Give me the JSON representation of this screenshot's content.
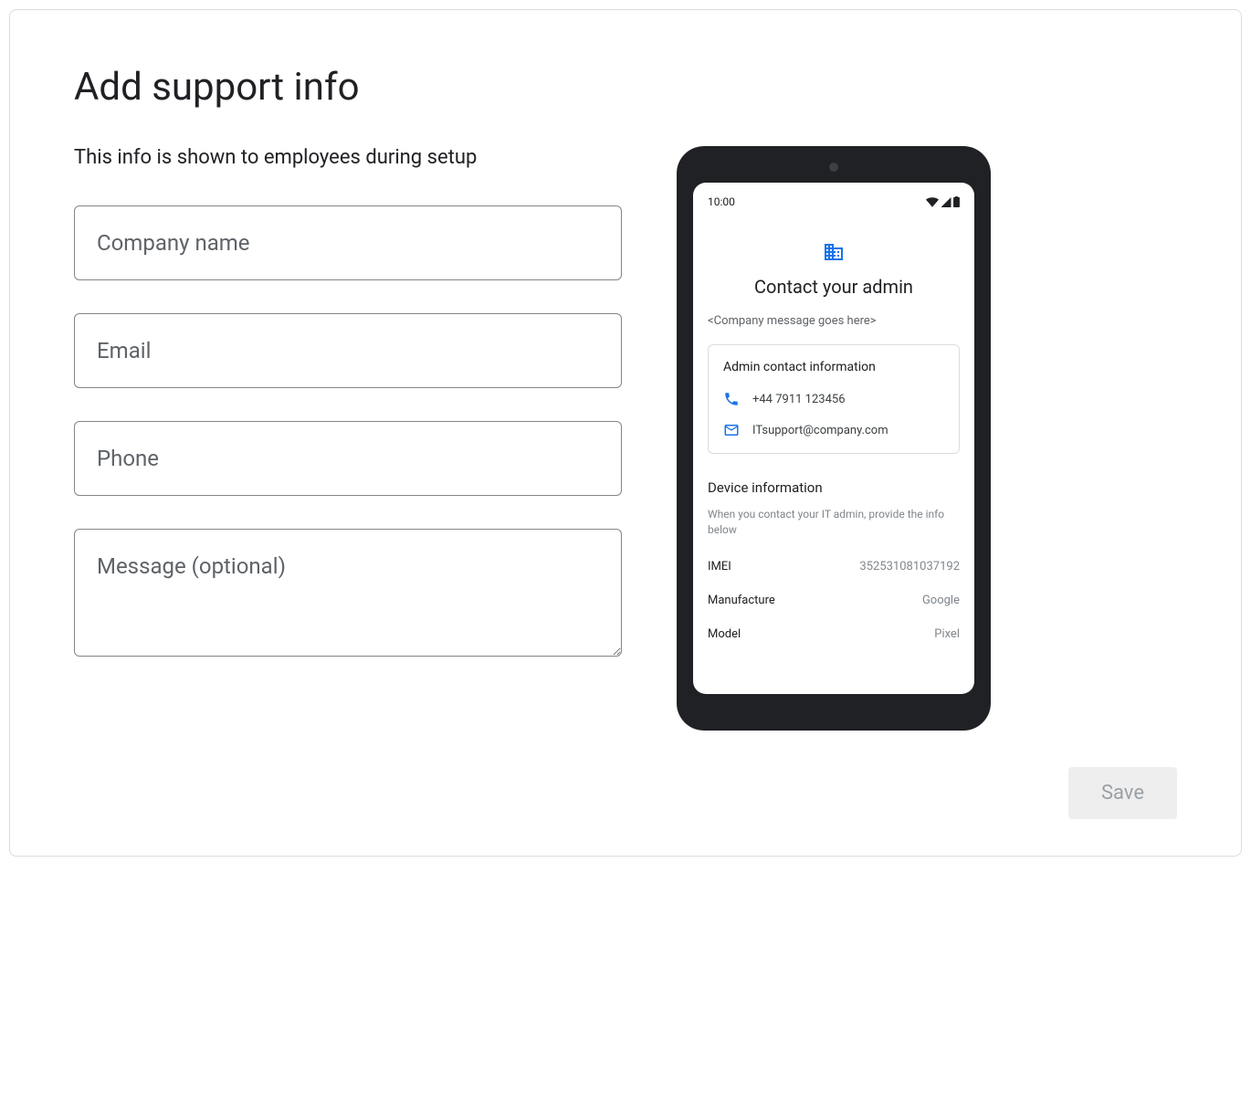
{
  "page": {
    "title": "Add support info",
    "subtitle": "This info is shown to employees during setup"
  },
  "form": {
    "company_placeholder": "Company name",
    "email_placeholder": "Email",
    "phone_placeholder": "Phone",
    "message_placeholder": "Message (optional)"
  },
  "preview": {
    "time": "10:00",
    "title": "Contact your admin",
    "message": "<Company message goes here>",
    "contact_heading": "Admin contact information",
    "phone": "+44 7911 123456",
    "email": "ITsupport@company.com",
    "device_heading": "Device information",
    "device_sub": "When you contact your IT admin, provide the info below",
    "rows": [
      {
        "label": "IMEI",
        "value": "352531081037192"
      },
      {
        "label": "Manufacture",
        "value": "Google"
      },
      {
        "label": "Model",
        "value": "Pixel"
      }
    ]
  },
  "actions": {
    "save": "Save"
  }
}
